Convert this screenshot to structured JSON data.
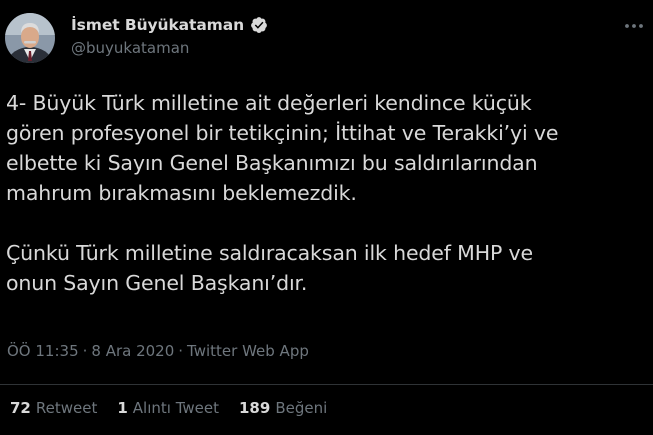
{
  "author": {
    "display_name": "İsmet Büyükataman",
    "handle": "@buyukataman",
    "verified": true
  },
  "tweet": {
    "text": "4- Büyük Türk milletine ait değerleri kendince küçük\ngören profesyonel bir tetikçinin; İttihat ve Terakki’yi ve\nelbette ki Sayın Genel Başkanımızı bu saldırılarından\nmahrum bırakmasını beklemezdik.\n\nÇünkü Türk milletine saldıracaksan ilk hedef MHP ve\nonun Sayın Genel Başkanı’dır."
  },
  "meta": {
    "time": "ÖÖ 11:35",
    "separator": "·",
    "date": "8 Ara 2020",
    "source": "Twitter Web App"
  },
  "stats": {
    "retweets_count": "72",
    "retweets_label": "Retweet",
    "quotes_count": "1",
    "quotes_label": "Alıntı Tweet",
    "likes_count": "189",
    "likes_label": "Beğeni"
  },
  "icons": {
    "verified": "verified-badge-icon",
    "more": "more-options-icon"
  },
  "colors": {
    "background": "#000000",
    "text_primary": "#d9d9d9",
    "text_secondary": "#6e767d",
    "divider": "#2f3336"
  }
}
